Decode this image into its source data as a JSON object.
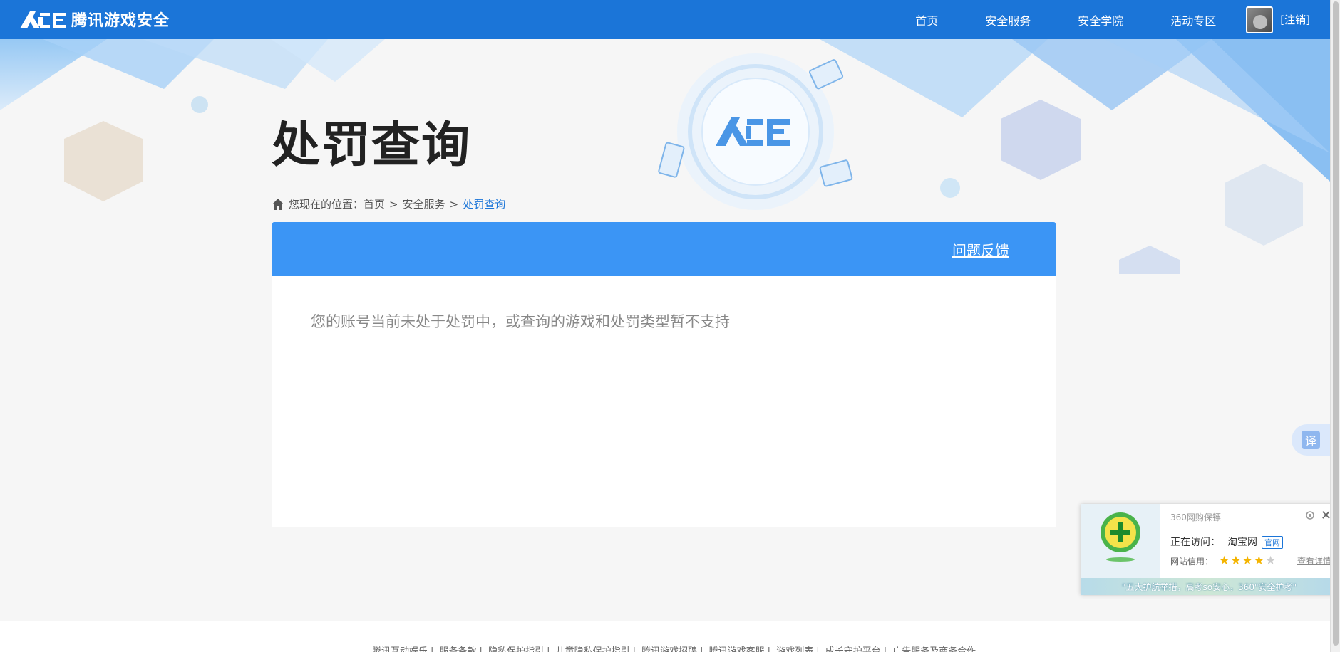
{
  "header": {
    "brand": "腾讯游戏安全",
    "nav": [
      "首页",
      "安全服务",
      "安全学院",
      "活动专区"
    ],
    "logout": "[注销]"
  },
  "page": {
    "title": "处罚查询",
    "breadcrumb": {
      "prefix": "您现在的位置：",
      "items": [
        "首页",
        "安全服务",
        "处罚查询"
      ]
    },
    "feedback": "问题反馈",
    "empty_message": "您的账号当前未处于处罚中，或查询的游戏和处罚类型暂不支持"
  },
  "footer": {
    "links": [
      "腾讯互动娱乐",
      "服务条款",
      "隐私保护指引",
      "儿童隐私保护指引",
      "腾讯游戏招聘",
      "腾讯游戏客服",
      "游戏列表",
      "成长守护平台",
      "广告服务及商务合作"
    ]
  },
  "translate": {
    "label": "译"
  },
  "popup": {
    "brand": "360网购保镖",
    "visiting_label": "正在访问：",
    "site": "淘宝网",
    "tag": "官网",
    "credit_label": "网站信用：",
    "rating": 4,
    "rating_max": 5,
    "detail": "查看详情",
    "banner_text": "\"五大护航举措，高考so安心，360\"安全护考\""
  },
  "colors": {
    "header_bg": "#1b75d8",
    "panel_head_bg": "#3b95f5",
    "accent": "#1b75d8"
  }
}
